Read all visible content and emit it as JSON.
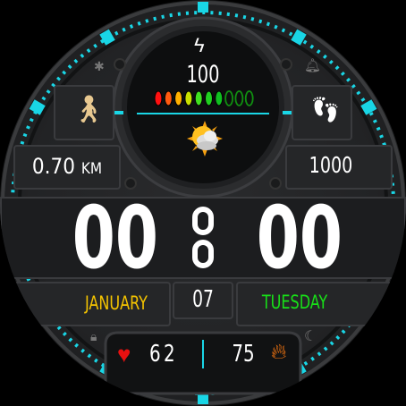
{
  "battery": {
    "icon": "lightning-bolt-icon",
    "value": "100",
    "segments_total": 10,
    "segments_filled": 7,
    "segment_colors": [
      "#ff1010",
      "#ff5a10",
      "#ffb000",
      "#c8e000",
      "#40e020",
      "#20d020",
      "#10c020",
      "#109010",
      "#109010",
      "#109010"
    ]
  },
  "weather": {
    "icon": "partly-cloudy-sun-icon"
  },
  "left": {
    "icon": "walking-person-icon",
    "distance_value": "0.70",
    "distance_unit": "KM"
  },
  "right": {
    "icon": "footprints-icon",
    "steps": "1000"
  },
  "time": {
    "hours": "00",
    "minutes": "00"
  },
  "date": {
    "month": "JANUARY",
    "day": "07",
    "weekday": "TUESDAY"
  },
  "bottom": {
    "heart_rate": "62",
    "calories": "75"
  },
  "status_icons": [
    "bluetooth-icon",
    "alarm-bell-icon",
    "lock-icon",
    "moon-icon"
  ],
  "colors": {
    "accent": "#19d6e6",
    "month": "#f5c400",
    "weekday": "#18e018",
    "heart": "#e81010",
    "flame": "#ff7a10"
  }
}
